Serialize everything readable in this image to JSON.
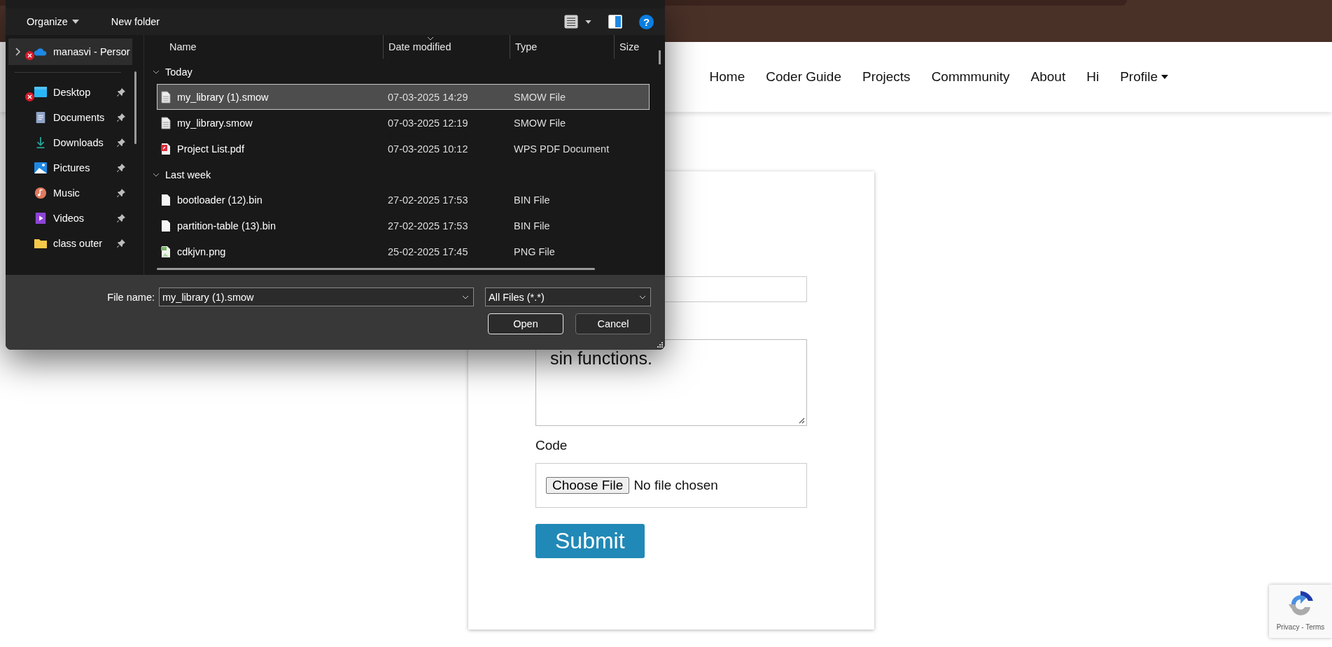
{
  "navbar": {
    "items": [
      {
        "label": "Home",
        "kind": "link"
      },
      {
        "label": "Coder Guide",
        "kind": "link"
      },
      {
        "label": "Projects",
        "kind": "link"
      },
      {
        "label": "Commmunity",
        "kind": "link"
      },
      {
        "label": "About",
        "kind": "link"
      },
      {
        "label": "Hi",
        "kind": "link"
      },
      {
        "label": "Profile",
        "kind": "dropdown"
      }
    ]
  },
  "form": {
    "fields": [
      {
        "kind": "input"
      },
      {
        "kind": "textarea",
        "value": "sin functions."
      },
      {
        "kind": "file",
        "label": "Code",
        "button": "Choose File",
        "status": "No file chosen"
      }
    ],
    "submit": "Submit"
  },
  "file_dialog": {
    "toolbar": {
      "organize": "Organize",
      "new_folder": "New folder",
      "help": "?"
    },
    "sidebar": {
      "items": [
        {
          "label": "manasvi - Persor",
          "kind": "cloud",
          "selected": true,
          "sync_error": true,
          "pinned": false
        },
        {
          "label": "Desktop",
          "kind": "desktop",
          "selected": false,
          "sync_error": true,
          "pinned": true
        },
        {
          "label": "Documents",
          "kind": "documents",
          "selected": false,
          "sync_error": false,
          "pinned": true
        },
        {
          "label": "Downloads",
          "kind": "downloads",
          "selected": false,
          "sync_error": false,
          "pinned": true
        },
        {
          "label": "Pictures",
          "kind": "pictures",
          "selected": false,
          "sync_error": false,
          "pinned": true
        },
        {
          "label": "Music",
          "kind": "music",
          "selected": false,
          "sync_error": false,
          "pinned": true
        },
        {
          "label": "Videos",
          "kind": "videos",
          "selected": false,
          "sync_error": false,
          "pinned": true
        },
        {
          "label": "class outer",
          "kind": "folder",
          "selected": false,
          "sync_error": false,
          "pinned": true
        }
      ]
    },
    "columns": [
      {
        "label": "Name",
        "sorted": false
      },
      {
        "label": "Date modified",
        "sorted": true
      },
      {
        "label": "Type",
        "sorted": false
      },
      {
        "label": "Size",
        "sorted": false
      }
    ],
    "groups": [
      {
        "label": "Today",
        "expanded": true,
        "files": [
          {
            "name": "my_library (1).smow",
            "date": "07-03-2025 14:29",
            "type": "SMOW File",
            "kind": "document",
            "selected": true
          },
          {
            "name": "my_library.smow",
            "date": "07-03-2025 12:19",
            "type": "SMOW File",
            "kind": "document",
            "selected": false
          },
          {
            "name": "Project List.pdf",
            "date": "07-03-2025 10:12",
            "type": "WPS PDF Document",
            "kind": "pdf",
            "selected": false
          }
        ]
      },
      {
        "label": "Last week",
        "expanded": true,
        "files": [
          {
            "name": "bootloader (12).bin",
            "date": "27-02-2025 17:53",
            "type": "BIN File",
            "kind": "blank",
            "selected": false
          },
          {
            "name": "partition-table (13).bin",
            "date": "27-02-2025 17:53",
            "type": "BIN File",
            "kind": "blank",
            "selected": false
          },
          {
            "name": "cdkjvn.png",
            "date": "25-02-2025 17:45",
            "type": "PNG File",
            "kind": "image",
            "selected": false
          }
        ]
      }
    ],
    "file_name_label": "File name:",
    "file_name_value": "my_library (1).smow",
    "filter": "All Files (*.*)",
    "buttons": [
      {
        "label": "Open",
        "default": true
      },
      {
        "label": "Cancel",
        "default": false
      }
    ]
  },
  "recaptcha": {
    "links": "Privacy - Terms"
  }
}
